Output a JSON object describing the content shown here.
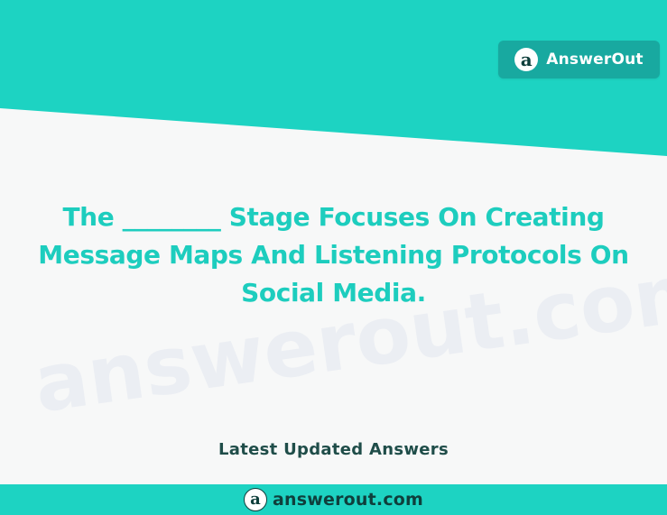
{
  "brand": {
    "logo_glyph": "a",
    "name": "AnswerOut"
  },
  "question": {
    "text": "The ________ Stage Focuses On Creating Message Maps And Listening Protocols On Social Media."
  },
  "section": {
    "subtitle": "Latest Updated Answers"
  },
  "footer": {
    "logo_glyph": "a",
    "url": "answerout.com"
  },
  "watermark": {
    "text": "answerout.com"
  },
  "colors": {
    "teal": "#1dd3c2",
    "question_text": "#1dcdbe",
    "badge": "#18a9a0",
    "dark_text": "#1f4d49",
    "background": "#f7f8f8"
  }
}
